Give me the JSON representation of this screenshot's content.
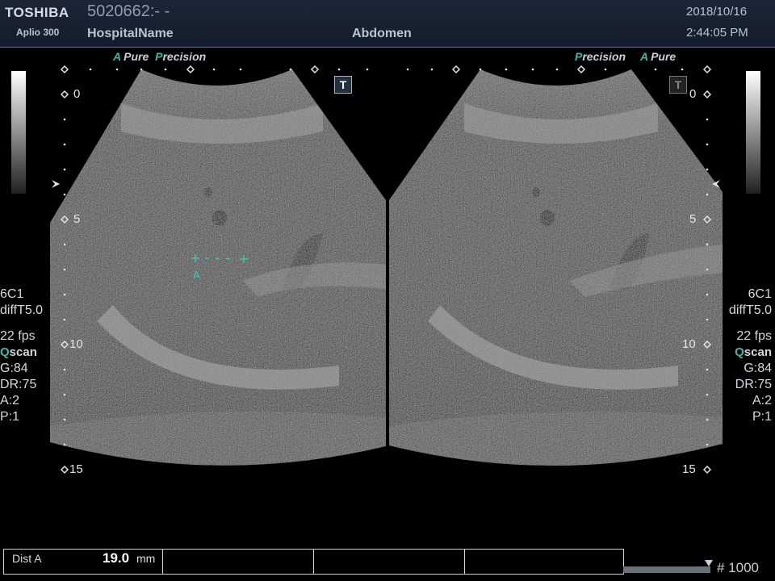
{
  "header": {
    "brand": "TOSHIBA",
    "model": "Aplio 300",
    "patient_id": "5020662:- -",
    "hospital": "HospitalName",
    "preset": "Abdomen",
    "date": "2018/10/16",
    "time": "2:44:05 PM"
  },
  "left_image": {
    "features": [
      {
        "mark": "A",
        "label": "Pure"
      },
      {
        "mark": "P",
        "label": "recision"
      }
    ],
    "depth_labels": [
      "0",
      "5",
      "10",
      "15"
    ],
    "measurement_marker": "A",
    "params": {
      "probe": "6C1",
      "mode": "diffT5.0",
      "fps": "22 fps",
      "qscan_q": "Q",
      "qscan_rest": "scan",
      "gain": "G:84",
      "dr": "DR:75",
      "a": "A:2",
      "p": "P:1"
    },
    "t_button": "T"
  },
  "right_image": {
    "features": [
      {
        "mark": "P",
        "label": "recision"
      },
      {
        "mark": "A",
        "label": "Pure"
      }
    ],
    "depth_labels": [
      "0",
      "5",
      "10",
      "15"
    ],
    "params": {
      "probe": "6C1",
      "mode": "diffT5.0",
      "fps": "22 fps",
      "qscan_q": "Q",
      "qscan_rest": "scan",
      "gain": "G:84",
      "dr": "DR:75",
      "a": "A:2",
      "p": "P:1"
    },
    "t_button": "T"
  },
  "measurements": {
    "label": "Dist A",
    "value": "19.0",
    "unit": "mm"
  },
  "footer": {
    "frame": "# 1000"
  }
}
